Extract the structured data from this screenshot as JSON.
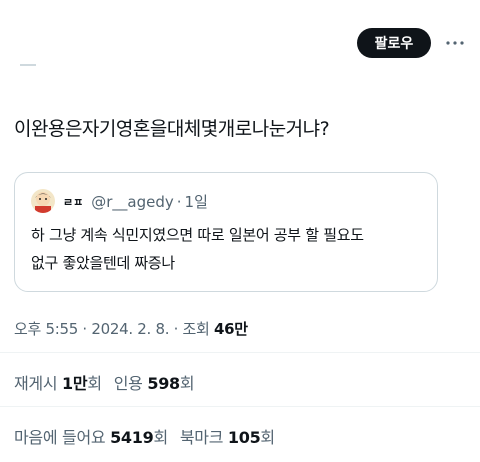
{
  "header": {
    "follow_label": "팔로우",
    "more_icon": "more-horizontal-icon"
  },
  "tweet": {
    "text": "이완용은자기영혼을대체몇개로나눈거냐?"
  },
  "quote": {
    "display_name": "ㄹㅍ",
    "handle": "@r__agedy",
    "separator": "·",
    "time": "1일",
    "body_line1": "하 그냥 계속 식민지였으면 따로 일본어 공부 할 필요도",
    "body_line2": "없구 좋았을텐데 짜증나"
  },
  "meta": {
    "time_date": "오후 5:55 · 2024. 2. 8. · 조회 ",
    "views_value": "46만"
  },
  "stats": {
    "retweets_label": "재게시 ",
    "retweets_value": "1만",
    "retweets_suffix": "회",
    "quotes_label": "인용 ",
    "quotes_value": "598",
    "quotes_suffix": "회",
    "likes_label": "마음에 들어요 ",
    "likes_value": "5419",
    "likes_suffix": "회",
    "bookmarks_label": "북마크 ",
    "bookmarks_value": "105",
    "bookmarks_suffix": "회"
  }
}
